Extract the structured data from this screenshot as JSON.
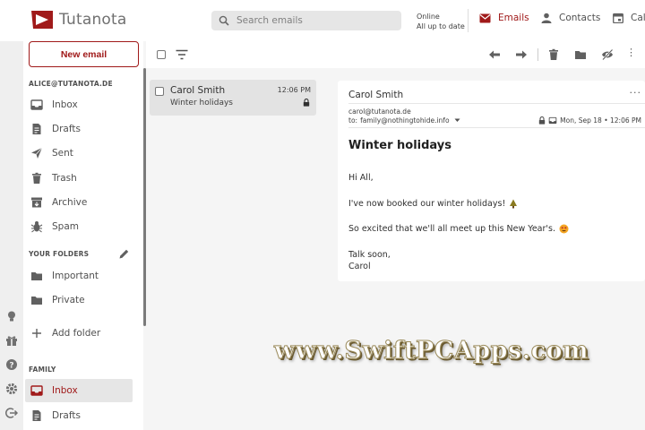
{
  "app": {
    "logo_text": "Tutanota",
    "brand_color": "#a01a1a"
  },
  "header": {
    "search_placeholder": "Search emails",
    "status_line1": "Online",
    "status_line2": "All up to date",
    "nav": [
      {
        "label": "Emails",
        "icon": "envelope-icon",
        "active": true
      },
      {
        "label": "Contacts",
        "icon": "person-icon",
        "active": false
      },
      {
        "label": "Cale",
        "icon": "calendar-icon",
        "active": false
      }
    ]
  },
  "sidebar": {
    "new_email_label": "New email",
    "account_label": "ALICE@TUTANOTA.DE",
    "system_folders": [
      {
        "label": "Inbox",
        "icon": "inbox-icon"
      },
      {
        "label": "Drafts",
        "icon": "draft-icon"
      },
      {
        "label": "Sent",
        "icon": "send-icon"
      },
      {
        "label": "Trash",
        "icon": "trash-icon"
      },
      {
        "label": "Archive",
        "icon": "archive-icon"
      },
      {
        "label": "Spam",
        "icon": "spam-icon"
      }
    ],
    "your_folders_label": "YOUR FOLDERS",
    "custom_folders": [
      {
        "label": "Important",
        "icon": "folder-icon"
      },
      {
        "label": "Private",
        "icon": "folder-icon"
      }
    ],
    "add_folder_label": "Add folder",
    "family_label": "FAMILY",
    "family_folders": [
      {
        "label": "Inbox",
        "icon": "inbox-icon",
        "active": true
      },
      {
        "label": "Drafts",
        "icon": "draft-icon",
        "active": false
      }
    ]
  },
  "mail_list": [
    {
      "from": "Carol Smith",
      "subject": "Winter holidays",
      "time": "12:06 PM",
      "encrypted": true
    }
  ],
  "email": {
    "from_name": "Carol Smith",
    "from_address": "carol@tutanota.de",
    "to_label": "to:",
    "to_address": "family@nothingtohide.info",
    "date": "Mon, Sep 18 • 12:06 PM",
    "subject": "Winter holidays",
    "body": {
      "greeting": "Hi All,",
      "line1": "I've now booked our winter holidays!",
      "line2": "So excited that we'll all meet up this New Year's.",
      "closing": "Talk soon,",
      "signature": "Carol"
    }
  },
  "watermark": "www.SwiftPCApps.com"
}
